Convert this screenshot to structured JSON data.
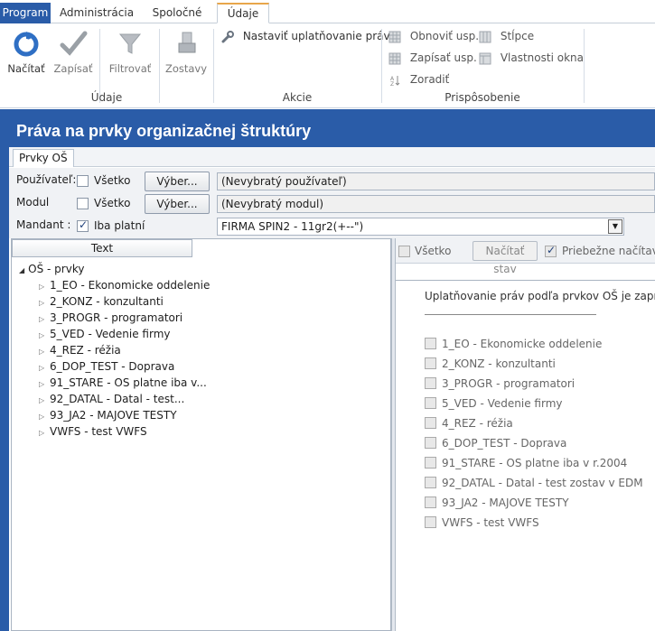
{
  "tabs": {
    "program": "Program",
    "administracia": "Administrácia",
    "spolocne": "Spoločné",
    "udaje": "Údaje"
  },
  "ribbon": {
    "nacitat": "Načítať",
    "zapisat": "Zapísať",
    "filtrovat": "Filtrovať",
    "zostavy": "Zostavy",
    "group_udaje": "Údaje",
    "nastavit": "Nastaviť uplatňovanie práv",
    "group_akcie": "Akcie",
    "obnovit_usp": "Obnoviť usp.",
    "zapisat_usp": "Zapísať usp.",
    "zoradit": "Zoradiť",
    "stlpce": "Stĺpce",
    "vlastnosti_okna": "Vlastnosti okna",
    "group_prisposobenie": "Prispôsobenie"
  },
  "window": {
    "title": "Práva na prvky organizačnej štruktúry",
    "subtab": "Prvky OŠ"
  },
  "filters": {
    "pouzivatel_label": "Používateľ:",
    "modul_label": "Modul",
    "mandant_label": "Mandant :",
    "vsetko": "Všetko",
    "iba_platni": "Iba platní",
    "vyber": "Výber...",
    "pouzivatel_value": "(Nevybratý používateľ)",
    "modul_value": "(Nevybratý modul)",
    "mandant_value": "FIRMA SPIN2 - 11gr2(+--\")"
  },
  "tree": {
    "column": "Text",
    "root": "OŠ - prvky",
    "items": [
      "1_EO - Ekonomicke oddelenie",
      "2_KONZ - konzultanti",
      "3_PROGR - programatori",
      "5_VED - Vedenie firmy",
      "4_REZ - réžia",
      "6_DOP_TEST - Doprava",
      "91_STARE - OS platne iba v...",
      "92_DATAL - Datal - test...",
      "93_JA2 - MAJOVE TESTY",
      "VWFS - test VWFS"
    ]
  },
  "right": {
    "vsetko": "Všetko",
    "nacitat_stav": "Načítať stav",
    "priebezne": "Priebežne načítavať s",
    "info": "Uplatňovanie práv podľa prvkov OŠ je zapnuté.",
    "items": [
      "1_EO - Ekonomicke oddelenie",
      "2_KONZ - konzultanti",
      "3_PROGR - programatori",
      "5_VED - Vedenie firmy",
      "4_REZ - réžia",
      "6_DOP_TEST - Doprava",
      "91_STARE - OS platne iba v r.2004",
      "92_DATAL - Datal - test zostav v EDM",
      "93_JA2 - MAJOVE TESTY",
      "VWFS - test VWFS"
    ]
  },
  "colors": {
    "accent": "#2a5ca8",
    "tab_orange_border": "#e8a64a"
  }
}
